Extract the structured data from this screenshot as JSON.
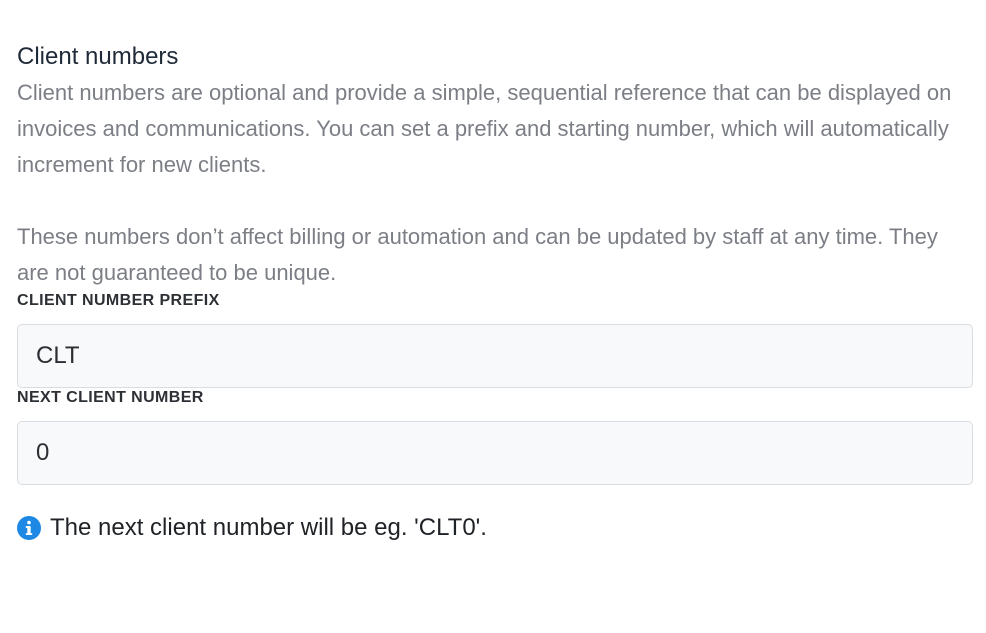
{
  "section": {
    "title": "Client numbers",
    "description_1": "Client numbers are optional and provide a simple, sequential reference that can be displayed on invoices and communications. You can set a prefix and starting number, which will automatically increment for new clients.",
    "description_2": "These numbers don’t affect billing or automation and can be updated by staff at any time. They are not guaranteed to be unique."
  },
  "fields": {
    "prefix": {
      "label": "CLIENT NUMBER PREFIX",
      "value": "CLT"
    },
    "next_number": {
      "label": "NEXT CLIENT NUMBER",
      "value": "0"
    }
  },
  "hint": {
    "icon": "info-icon",
    "text": "The next client number will be eg. 'CLT0'."
  },
  "colors": {
    "info_icon": "#1e88e5",
    "description_text": "#7b7f85",
    "input_background": "#f8f9fa",
    "input_border": "#d9dce1"
  }
}
